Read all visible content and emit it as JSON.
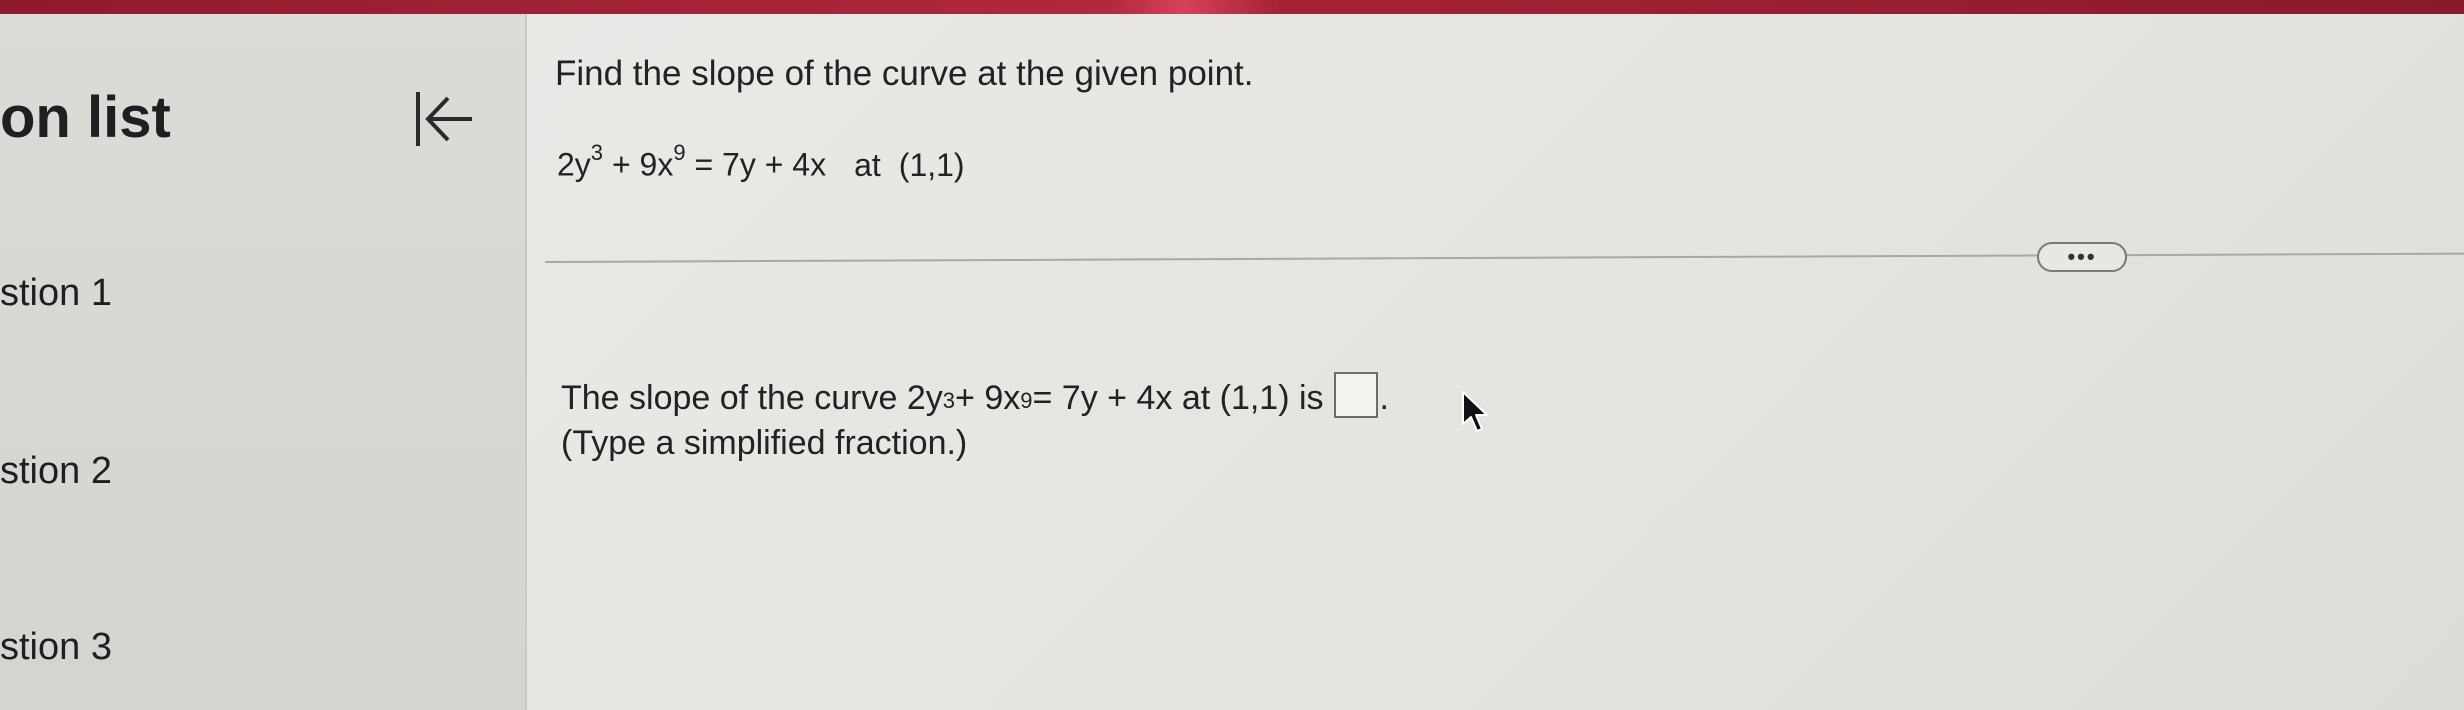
{
  "sidebar": {
    "title": "on list",
    "items": [
      {
        "label": "stion 1"
      },
      {
        "label": "stion 2"
      },
      {
        "label": "stion 3"
      }
    ]
  },
  "question": {
    "instruction": "Find the slope of the curve at the given point.",
    "equation": {
      "c1": "2y",
      "e1": "3",
      "c2": " + 9x",
      "e2": "9",
      "c3": " = 7y + 4x",
      "at": "at",
      "point": "(1,1)"
    },
    "answer": {
      "prefix": "The slope of the curve 2y",
      "e1": "3",
      "mid": " + 9x",
      "e2": "9",
      "suffix": " = 7y + 4x at (1,1) is",
      "period": ".",
      "hint": "(Type a simplified fraction.)"
    },
    "more_label": "•••"
  },
  "colors": {
    "top_bar": "#a52236",
    "sidebar_bg": "#d8d7d3",
    "main_bg": "#e6e5e1",
    "text": "#222222"
  }
}
